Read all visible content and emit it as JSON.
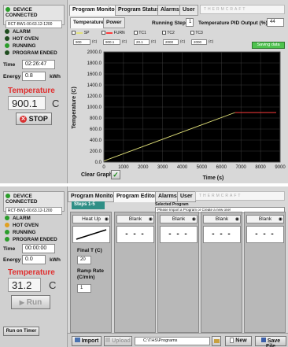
{
  "panel1": {
    "connection": {
      "label": "DEVICE CONNECTED",
      "serial": "RCT-BW1-00.63.12-1200"
    },
    "statuses": [
      {
        "label": "ALARM",
        "color": "#1f4d1f"
      },
      {
        "label": "HOT OVEN",
        "color": "#1f4d1f"
      },
      {
        "label": "RUNNING",
        "color": "#2a9d2a"
      },
      {
        "label": "PROGRAM ENDED",
        "color": "#1f4d1f"
      }
    ],
    "time_label": "Time",
    "time_value": "02:26:47",
    "energy_label": "Energy",
    "energy_value": "0.8",
    "energy_unit": "kWh",
    "temperature_label": "Temperature",
    "temperature_value": "900.1",
    "temperature_unit": "C",
    "stop_label": "STOP",
    "tabs": [
      "Program Monitor",
      "Program Status",
      "Alarms",
      "User"
    ],
    "brand": "THERMCRAFT",
    "subtabs": [
      "Temperature",
      "Power"
    ],
    "running_step_label": "Running Step",
    "running_step_value": "1",
    "pid_label": "Temperature PID Output (%)",
    "pid_value": "44",
    "legend": [
      {
        "name": "SP",
        "value": "900"
      },
      {
        "name": "FURN",
        "value": "900.1"
      },
      {
        "name": "TC1",
        "value": "20.1"
      },
      {
        "name": "TC2",
        "value": "2000"
      },
      {
        "name": "TC3",
        "value": "2000"
      }
    ],
    "legend_unit": "(C)",
    "saving_label": "Saving data",
    "clear_graph_label": "Clear Graph"
  },
  "chart_data": {
    "type": "line",
    "xlabel": "Time (s)",
    "ylabel": "Temperature (C)",
    "xlim": [
      0,
      9000
    ],
    "ylim": [
      0,
      2000
    ],
    "x_ticks": [
      0,
      1000,
      2000,
      3000,
      4000,
      5000,
      6000,
      7000,
      8000,
      9000
    ],
    "y_ticks": [
      "0.0",
      "200.0",
      "400.0",
      "600.0",
      "800.0",
      "1000.0",
      "1200.0",
      "1400.0",
      "1600.0",
      "1800.0",
      "2000.0"
    ],
    "grid": true,
    "background": "#000000",
    "series": [
      {
        "color": "#e2e27a",
        "x": [
          0,
          6700
        ],
        "y": [
          20,
          900
        ]
      },
      {
        "color": "#ff3b3b",
        "x": [
          6700,
          8800
        ],
        "y": [
          900,
          900
        ]
      }
    ]
  },
  "panel2": {
    "connection": {
      "label": "DEVICE CONNECTED",
      "serial": "RCT-BW1-00.63.12-1200"
    },
    "statuses": [
      {
        "label": "ALARM",
        "color": "#2a9d2a"
      },
      {
        "label": "HOT OVEN",
        "color": "#e0a020"
      },
      {
        "label": "RUNNING",
        "color": "#2a9d2a"
      },
      {
        "label": "PROGRAM ENDED",
        "color": "#2a9d2a"
      }
    ],
    "time_label": "Time",
    "time_value": "00:00:00",
    "energy_label": "Energy",
    "energy_value": "0.0",
    "energy_unit": "kWh",
    "temperature_label": "Temperature",
    "temperature_value": "31.2",
    "temperature_unit": "C",
    "run_label": "Run",
    "run_on_timer_label": "Run on Timer",
    "tabs": [
      "Program Monitor",
      "Program Editor",
      "Alarms",
      "User"
    ],
    "brand": "THERMCRAFT",
    "steps_label": "Steps 1-5",
    "selected_program_label": "Selected Program",
    "selected_program_value": "Please Import a Program or Create a new one!",
    "step1": {
      "name": "Heat Up",
      "final_t_label": "Final T (C)",
      "final_t_value": "20",
      "ramp_label": "Ramp Rate (C/min)",
      "ramp_value": "1"
    },
    "blank_label": "Blank",
    "dashes": "- - -",
    "import_label": "Import",
    "upload_label": "Upload",
    "path_value": "C:\\THS\\Programs",
    "new_label": "New",
    "save_label": "Save File"
  }
}
